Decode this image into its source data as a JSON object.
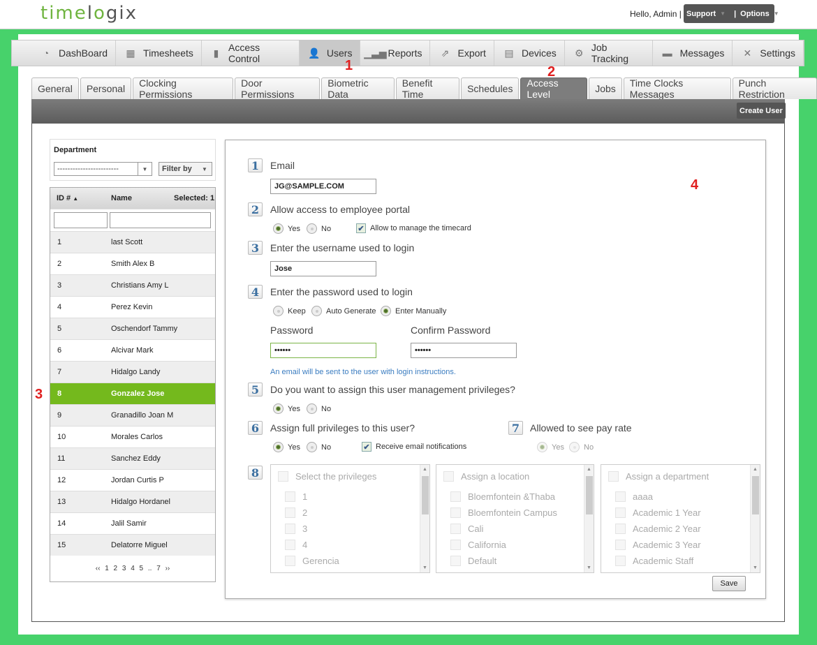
{
  "header": {
    "logo_a": "time",
    "logo_b": "l",
    "logo_c": "o",
    "logo_d": "gix",
    "greeting": "Hello, Admin |",
    "support": "Support",
    "sep": "|",
    "options": "Options"
  },
  "nav": [
    {
      "label": "DashBoard",
      "icon": "dashboard-icon",
      "glyph": "◔"
    },
    {
      "label": "Timesheets",
      "icon": "calendar-icon",
      "glyph": "▦"
    },
    {
      "label": "Access Control",
      "icon": "door-icon",
      "glyph": "▮"
    },
    {
      "label": "Users",
      "icon": "user-icon",
      "glyph": "👤"
    },
    {
      "label": "Reports",
      "icon": "bar-chart-icon",
      "glyph": "▁▃▅"
    },
    {
      "label": "Export",
      "icon": "export-icon",
      "glyph": "⇗"
    },
    {
      "label": "Devices",
      "icon": "devices-icon",
      "glyph": "▤"
    },
    {
      "label": "Job Tracking",
      "icon": "job-tracking-icon",
      "glyph": "⚙"
    },
    {
      "label": "Messages",
      "icon": "message-icon",
      "glyph": "▬"
    },
    {
      "label": "Settings",
      "icon": "tools-icon",
      "glyph": "✕"
    }
  ],
  "tabs": [
    "General",
    "Personal",
    "Clocking Permissions",
    "Door Permissions",
    "Biometric Data",
    "Benefit Time",
    "Schedules",
    "Access Level",
    "Jobs",
    "Time Clocks Messages",
    "Punch Restriction"
  ],
  "create_user": "Create User",
  "filter": {
    "department_label": "Department",
    "department_value": "------------------------",
    "filter_by": "Filter by"
  },
  "list": {
    "col_id": "ID #",
    "col_name": "Name",
    "selected": "Selected: 1",
    "sort_glyph": "▲",
    "rows": [
      {
        "id": "1",
        "name": "last Scott"
      },
      {
        "id": "2",
        "name": "Smith Alex B"
      },
      {
        "id": "3",
        "name": "Christians Amy L"
      },
      {
        "id": "4",
        "name": "Perez Kevin"
      },
      {
        "id": "5",
        "name": "Oschendorf Tammy"
      },
      {
        "id": "6",
        "name": "Alcivar Mark"
      },
      {
        "id": "7",
        "name": "Hidalgo Landy"
      },
      {
        "id": "8",
        "name": "Gonzalez Jose"
      },
      {
        "id": "9",
        "name": "Granadillo Joan M"
      },
      {
        "id": "10",
        "name": "Morales Carlos"
      },
      {
        "id": "11",
        "name": "Sanchez Eddy"
      },
      {
        "id": "12",
        "name": "Jordan Curtis P"
      },
      {
        "id": "13",
        "name": "Hidalgo Hordanel"
      },
      {
        "id": "14",
        "name": "Jalil Samir"
      },
      {
        "id": "15",
        "name": "Delatorre Miguel"
      }
    ],
    "pager": "‹‹ 1 2 3 4 5 .. 7 ››"
  },
  "form": {
    "n1": "1",
    "q1": "Email",
    "email": "JG@SAMPLE.COM",
    "n2": "2",
    "q2": "Allow access to employee portal",
    "yes": "Yes",
    "no": "No",
    "manage_timecard": "Allow to manage the timecard",
    "n3": "3",
    "q3": "Enter the username used to login",
    "username": "Jose",
    "n4": "4",
    "q4": "Enter the password used to login",
    "keep": "Keep",
    "auto": "Auto Generate",
    "manual": "Enter Manually",
    "password_label": "Password",
    "confirm_label": "Confirm Password",
    "password_mask": "••••••",
    "confirm_mask": "••••••",
    "note": "An email will be sent to the user with login instructions.",
    "n5": "5",
    "q5": "Do you want to assign this user management privileges?",
    "n6": "6",
    "q6": "Assign full privileges to this user?",
    "receive_email": "Receive email notifications",
    "n7": "7",
    "q7": "Allowed to see pay rate",
    "n8": "8",
    "privileges": {
      "title": "Select the privileges",
      "items": [
        "1",
        "2",
        "3",
        "4",
        "Gerencia"
      ]
    },
    "locations": {
      "title": "Assign a location",
      "items": [
        "Bloemfontein &Thaba",
        "Bloemfontein Campus",
        "Cali",
        "California",
        "Default"
      ]
    },
    "departments": {
      "title": "Assign a department",
      "items": [
        "aaaa",
        "Academic 1 Year",
        "Academic 2 Year",
        "Academic 3 Year",
        "Academic Staff"
      ]
    },
    "save": "Save"
  },
  "annotations": [
    "1",
    "2",
    "3",
    "4"
  ]
}
